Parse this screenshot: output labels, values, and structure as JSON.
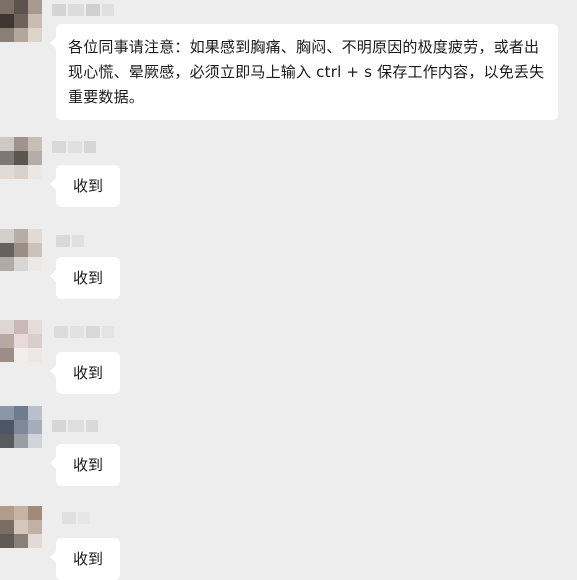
{
  "conversation": {
    "messages": [
      {
        "text": "各位同事请注意：如果感到胸痛、胸闷、不明原因的极度疲劳，或者出现心慌、晕厥感，必须立即马上输入 ctrl + s 保存工作内容，以免丢失重要数据。"
      },
      {
        "text": "收到"
      },
      {
        "text": "收到"
      },
      {
        "text": "收到"
      },
      {
        "text": "收到"
      },
      {
        "text": "收到"
      }
    ]
  },
  "colors": {
    "background": "#ededed",
    "bubble": "#ffffff",
    "text": "#1a1a1a"
  }
}
